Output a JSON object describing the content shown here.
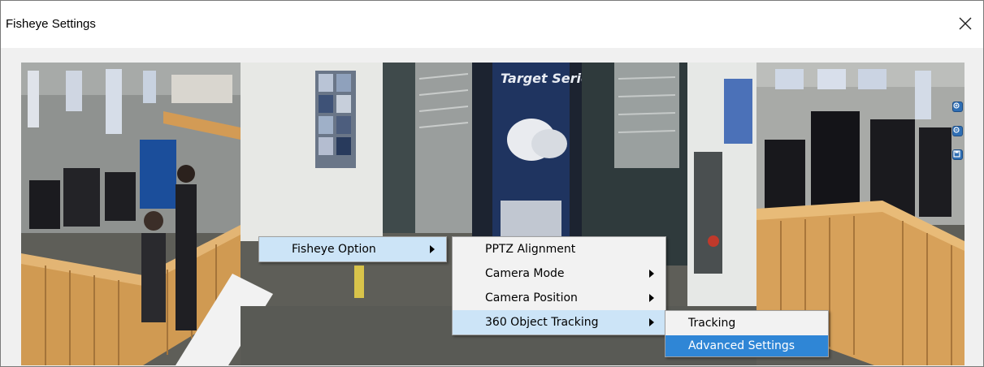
{
  "window": {
    "title": "Fisheye Settings",
    "close_icon": "close-x-icon"
  },
  "viewer": {
    "scene": "panoramic fisheye camera view of an office showroom",
    "banner_text": "Target Series",
    "side_tools": [
      "zoom-in-icon",
      "zoom-out-icon",
      "save-icon"
    ]
  },
  "context_menu": {
    "items": [
      {
        "label": "Fisheye Option",
        "has_submenu": true
      }
    ]
  },
  "fisheye_submenu": {
    "items": [
      {
        "label": "PPTZ Alignment",
        "has_submenu": false
      },
      {
        "label": "Camera Mode",
        "has_submenu": true
      },
      {
        "label": "Camera Position",
        "has_submenu": true
      },
      {
        "label": "360 Object Tracking",
        "has_submenu": true
      }
    ]
  },
  "tracking_submenu": {
    "items": [
      {
        "label": "Tracking"
      },
      {
        "label": "Advanced Settings"
      }
    ]
  },
  "colors": {
    "menu_bg": "#f2f2f2",
    "menu_hover": "#cce4f7",
    "menu_selected": "#2f86d6",
    "dialog_bg": "#f0f0f0"
  }
}
